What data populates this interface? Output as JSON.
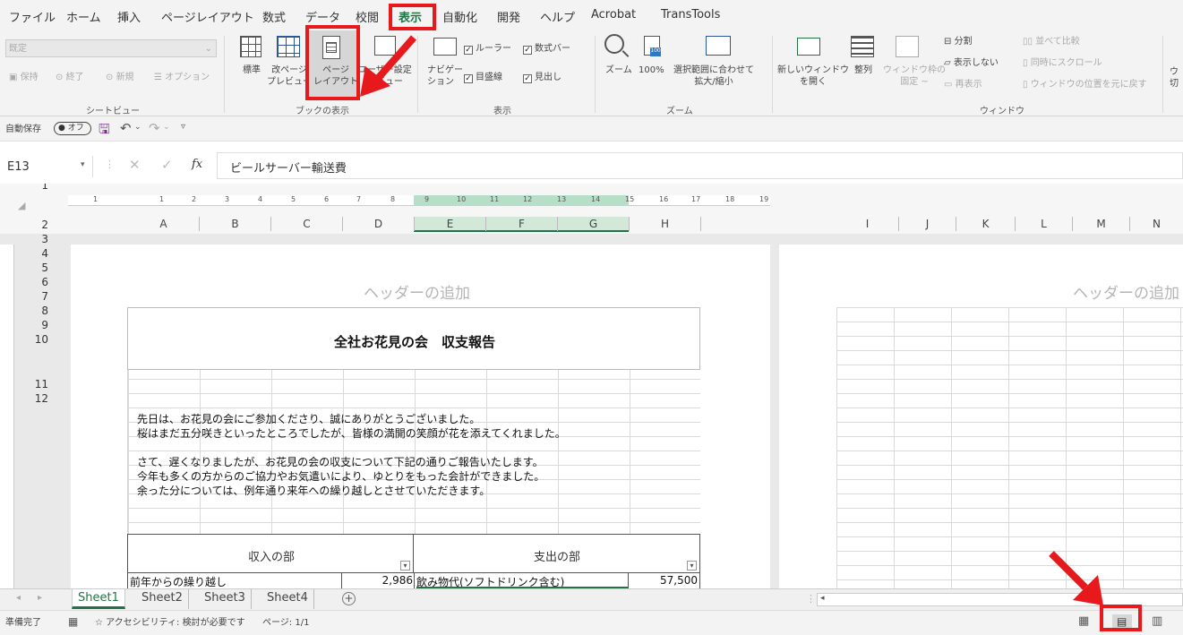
{
  "menu": [
    "ファイル",
    "ホーム",
    "挿入",
    "ページレイアウト",
    "数式",
    "データ",
    "校閲",
    "表示",
    "自動化",
    "開発",
    "ヘルプ",
    "Acrobat",
    "TransTools"
  ],
  "ribbon": {
    "sheet_view": {
      "dropdown": "既定",
      "keep": "保持",
      "exit": "終了",
      "new": "新規",
      "options": "オプション",
      "label": "シートビュー"
    },
    "workbook_views": {
      "normal": "標準",
      "page_break": "改ページ\nプレビュー",
      "page_layout": "ページ\nレイアウト",
      "custom": "ユーザー設定\nのビュー",
      "label": "ブックの表示"
    },
    "show": {
      "navigation": "ナビゲー\nション",
      "ruler": "ルーラー",
      "formula_bar": "数式バー",
      "gridlines": "目盛線",
      "headings": "見出し",
      "label": "表示"
    },
    "zoom": {
      "zoom": "ズーム",
      "hundred": "100%",
      "selection": "選択範囲に合わせて\n拡大/縮小",
      "label": "ズーム"
    },
    "window": {
      "new_window": "新しいウィンドウ\nを開く",
      "arrange": "整列",
      "freeze": "ウィンドウ枠の\n固定 ~",
      "split": "分割",
      "hide": "表示しない",
      "unhide": "再表示",
      "side_by_side": "並べて比較",
      "sync_scroll": "同時にスクロール",
      "reset_pos": "ウィンドウの位置を元に戻す",
      "label": "ウィンドウ",
      "cut": "ウ\n切"
    }
  },
  "qat": {
    "autosave": "自動保存",
    "toggle": "オフ"
  },
  "formula": {
    "name_box": "E13",
    "fx": "fx",
    "content": "ビールサーバー輸送費"
  },
  "ruler": [
    "1",
    "1",
    "2",
    "3",
    "4",
    "5",
    "6",
    "7",
    "8",
    "9",
    "10",
    "11",
    "12",
    "13",
    "14",
    "15",
    "16",
    "17",
    "18",
    "19"
  ],
  "columns_left": [
    "A",
    "B",
    "C",
    "D",
    "E",
    "F",
    "G",
    "H"
  ],
  "columns_right": [
    "I",
    "J",
    "K",
    "L",
    "M",
    "N"
  ],
  "rows": [
    "1",
    "2",
    "3",
    "4",
    "5",
    "6",
    "7",
    "8",
    "9",
    "10",
    "11",
    "12"
  ],
  "page": {
    "header_placeholder": "ヘッダーの追加",
    "title": "全社お花見の会　収支報告",
    "lines": [
      "先日は、お花見の会にご参加くださり、誠にありがとうございました。",
      "桜はまだ五分咲きといったところでしたが、皆様の満開の笑顔が花を添えてくれました。",
      "さて、遅くなりましたが、お花見の会の収支について下記の通りご報告いたします。",
      "今年も多くの方からのご協力やお気遣いにより、ゆとりをもった会計ができました。",
      "余った分については、例年通り来年への繰り越しとさせていただきます。"
    ],
    "income_header": "収入の部",
    "expense_header": "支出の部",
    "row12": {
      "income_item": "前年からの繰り越し",
      "income_amount": "2,986",
      "expense_item": "飲み物代(ソフトドリンク含む)",
      "expense_amount": "57,500"
    }
  },
  "tabs": [
    "Sheet1",
    "Sheet2",
    "Sheet3",
    "Sheet4"
  ],
  "status": {
    "ready": "準備完了",
    "accessibility": "アクセシビリティ: 検討が必要です",
    "page": "ページ: 1/1"
  },
  "colors": {
    "highlight": "#e8191d",
    "excel_green": "#217346"
  }
}
